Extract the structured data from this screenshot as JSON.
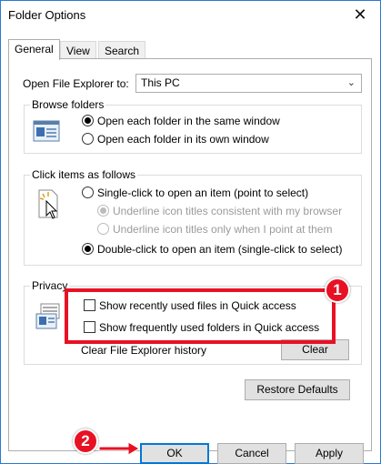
{
  "window": {
    "title": "Folder Options",
    "close_glyph": "✕"
  },
  "tabs": [
    {
      "label": "General",
      "active": true
    },
    {
      "label": "View",
      "active": false
    },
    {
      "label": "Search",
      "active": false
    }
  ],
  "general": {
    "open_explorer_label": "Open File Explorer to:",
    "open_explorer_value": "This PC",
    "browse": {
      "title": "Browse folders",
      "options": [
        {
          "label": "Open each folder in the same window",
          "selected": true
        },
        {
          "label": "Open each folder in its own window",
          "selected": false
        }
      ]
    },
    "click": {
      "title": "Click items as follows",
      "single": "Single-click to open an item (point to select)",
      "underline_consistent": "Underline icon titles consistent with my browser",
      "underline_point": "Underline icon titles only when I point at them",
      "double": "Double-click to open an item (single-click to select)"
    },
    "privacy": {
      "title": "Privacy",
      "show_recent_files": "Show recently used files in Quick access",
      "show_frequent_folders": "Show frequently used folders in Quick access",
      "clear_history_label": "Clear File Explorer history",
      "clear_button": "Clear"
    },
    "restore_button": "Restore Defaults"
  },
  "footer": {
    "ok": "OK",
    "cancel": "Cancel",
    "apply": "Apply"
  },
  "annotations": {
    "badge_1": "1",
    "badge_2": "2",
    "accent_color": "#e81123"
  }
}
